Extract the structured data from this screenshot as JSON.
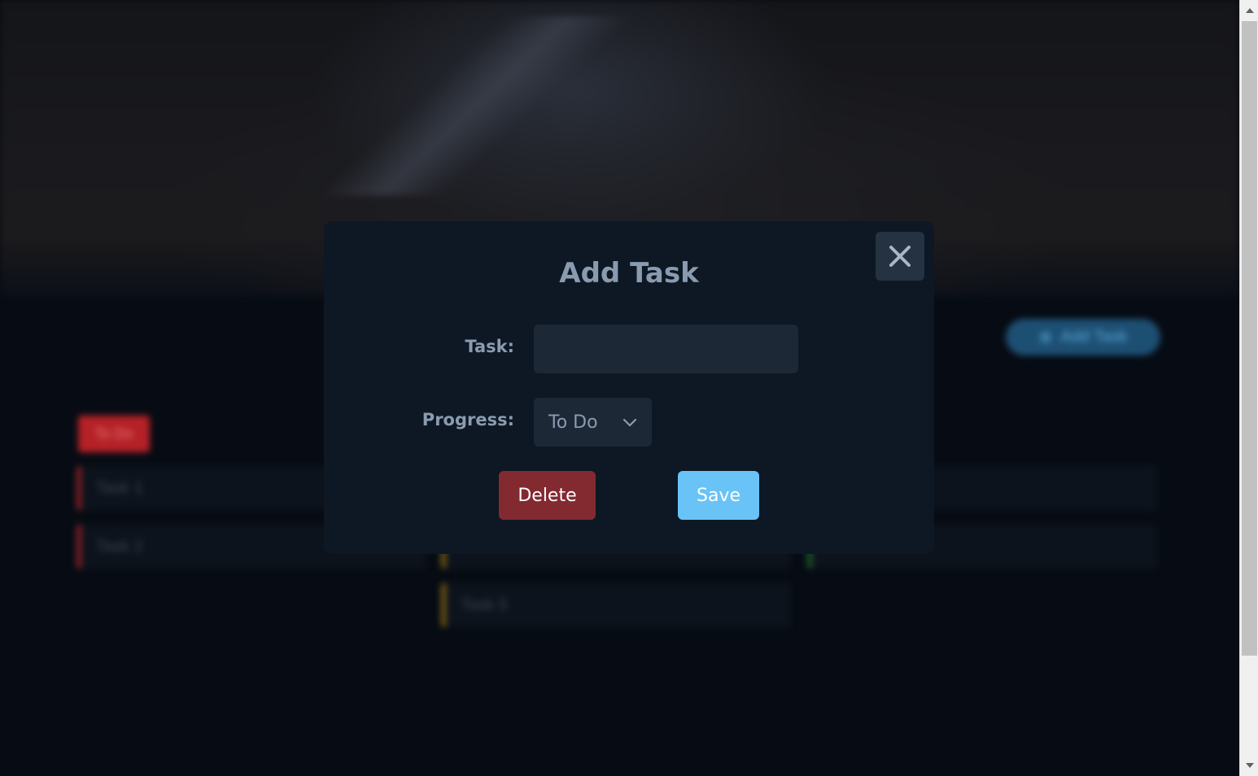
{
  "background_app": {
    "add_task_button": {
      "label": "Add Task",
      "icon": "plus-icon"
    },
    "columns": [
      {
        "title": "To Do",
        "cards": [
          {
            "label": "Task 1"
          },
          {
            "label": "Task 2"
          }
        ]
      },
      {
        "title": "",
        "cards": [
          {
            "label": ""
          },
          {
            "label": ""
          },
          {
            "label": "Task 5"
          }
        ]
      },
      {
        "title": "",
        "cards": [
          {
            "label": ""
          },
          {
            "label": ""
          }
        ]
      }
    ]
  },
  "modal": {
    "title": "Add Task",
    "close_icon": "close-icon",
    "task_label": "Task:",
    "task_value": "",
    "progress_label": "Progress:",
    "progress_selected": "To Do",
    "chevron_icon": "chevron-down-icon",
    "delete_label": "Delete",
    "save_label": "Save"
  },
  "colors": {
    "delete_button": "#832a31",
    "save_button": "#6ac3f7",
    "modal_background": "#0d1824"
  }
}
